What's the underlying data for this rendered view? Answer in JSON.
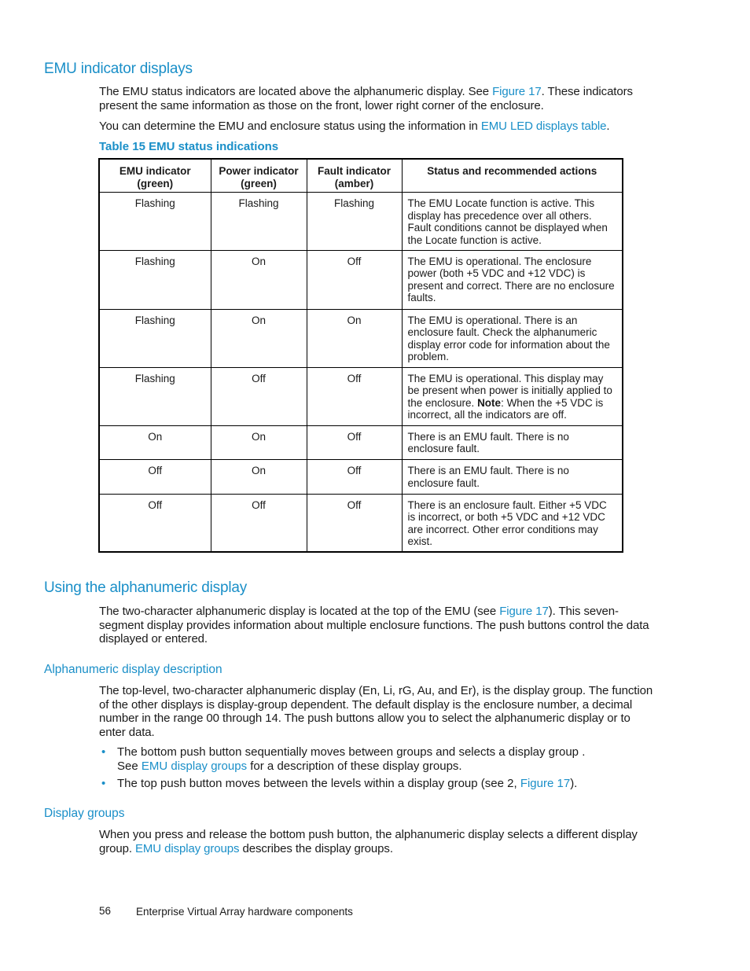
{
  "section1": {
    "heading": "EMU indicator displays",
    "para1": {
      "pre": "The EMU status indicators are located above the alphanumeric display.  See ",
      "link": "Figure 17",
      "post": ".  These indicators present the same information as those on the front, lower right corner of the enclosure."
    },
    "para2": {
      "pre": "You can determine the EMU and enclosure status using the information in ",
      "link": "EMU LED displays table",
      "post": "."
    },
    "table_caption": "Table 15 EMU status indications",
    "table": {
      "headers": [
        "EMU indicator (green)",
        "Power indicator (green)",
        "Fault indicator (amber)",
        "Status and recommended actions"
      ],
      "rows": [
        {
          "emu": "Flashing",
          "power": "Flashing",
          "fault": "Flashing",
          "status": "The EMU Locate function is active.  This display has precedence over all others. Fault conditions cannot be displayed when the Locate function is active."
        },
        {
          "emu": "Flashing",
          "power": "On",
          "fault": "Off",
          "status": "The EMU is operational.  The enclosure power (both +5 VDC and +12 VDC) is present and correct.  There are no enclosure faults."
        },
        {
          "emu": "Flashing",
          "power": "On",
          "fault": "On",
          "status": "The EMU is operational.  There is an enclosure fault.  Check the alphanumeric display error code for information about the problem."
        },
        {
          "emu": "Flashing",
          "power": "Off",
          "fault": "Off",
          "status_pre": "The EMU is operational.  This display may be present when power is initially applied to the enclosure.  ",
          "status_bold": "Note",
          "status_post": ":  When the +5 VDC is incorrect, all the indicators are off."
        },
        {
          "emu": "On",
          "power": "On",
          "fault": "Off",
          "status": "There is an EMU fault.  There is no enclosure fault."
        },
        {
          "emu": "Off",
          "power": "On",
          "fault": "Off",
          "status": "There is an EMU fault.  There is no enclosure fault."
        },
        {
          "emu": "Off",
          "power": "Off",
          "fault": "Off",
          "status": "There is an enclosure fault.  Either +5 VDC is incorrect, or both +5 VDC and +12 VDC are incorrect.  Other error conditions may exist."
        }
      ]
    }
  },
  "section2": {
    "heading": "Using the alphanumeric display",
    "para": {
      "pre": "The two-character alphanumeric display is located at the top of the EMU (see ",
      "link": "Figure 17",
      "post": ").  This seven-segment display provides information about multiple enclosure functions.  The push buttons control the data displayed or entered."
    }
  },
  "section3": {
    "heading": "Alphanumeric display description",
    "para": "The top-level, two-character alphanumeric display (En, Li, rG, Au, and Er), is the display group.  The function of the other displays is display-group dependent.  The default display is the enclosure number, a decimal number in the range 00 through 14.  The push buttons allow you to select the alphanumeric display or to enter data.",
    "bullets": [
      {
        "pre": "The bottom push button sequentially moves between groups and selects a display group . \nSee ",
        "link": "EMU display groups",
        "post": " for a description of these display groups."
      },
      {
        "pre": "The top push button moves between the levels within a display group (see 2, ",
        "link": "Figure 17",
        "post": ")."
      }
    ],
    "bullet_glyph": "•"
  },
  "section4": {
    "heading": "Display groups",
    "para": {
      "pre": "When you press and release the bottom push button, the alphanumeric display selects a different display group.  ",
      "link": "EMU display groups",
      "post": " describes the display groups."
    }
  },
  "footer": {
    "page_number": "56",
    "chapter_title": "Enterprise Virtual Array hardware components"
  },
  "colors": {
    "accent": "#1a8fc8",
    "text": "#1a1a1a"
  }
}
